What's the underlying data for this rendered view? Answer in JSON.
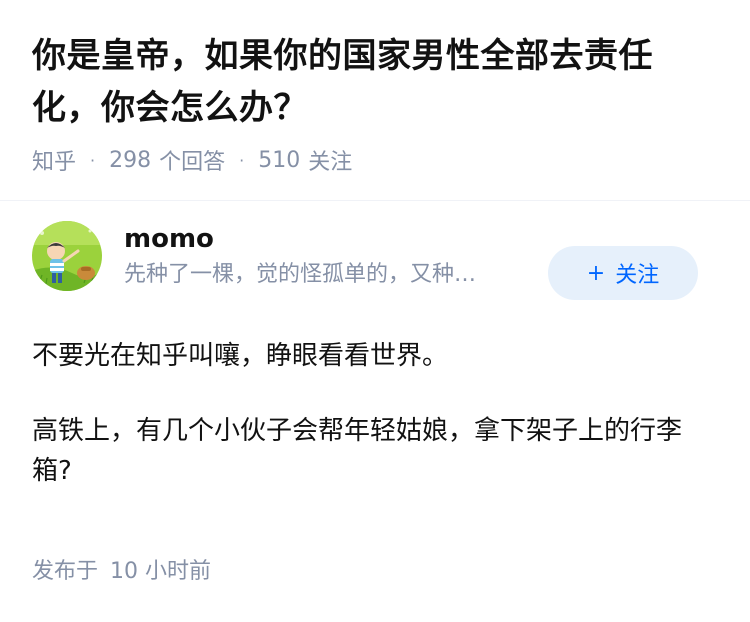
{
  "question": {
    "title": "你是皇帝，如果你的国家男性全部去责任化，你会怎么办？",
    "source": "知乎",
    "separator": "·",
    "answer_count": "298",
    "answer_label": "个回答",
    "follower_count": "510",
    "follower_label": "关注"
  },
  "answer": {
    "author": {
      "name": "momo",
      "bio": "先种了一棵，觉的怪孤单的，又种…",
      "avatar_icon": "avatar-cartoon-boy-on-grass"
    },
    "follow_button": {
      "plus": "+",
      "label": "关注"
    },
    "paragraphs": [
      "不要光在知乎叫嚷，睁眼看看世界。",
      "高铁上，有几个小伙子会帮年轻姑娘，拿下架子上的行李箱?"
    ],
    "time": {
      "prefix": "发布于",
      "value": "10 小时前"
    }
  },
  "colors": {
    "meta_gray": "#8590a6",
    "brand_blue": "#0066ff",
    "follow_bg": "#e6f0fb",
    "text": "#121212"
  }
}
